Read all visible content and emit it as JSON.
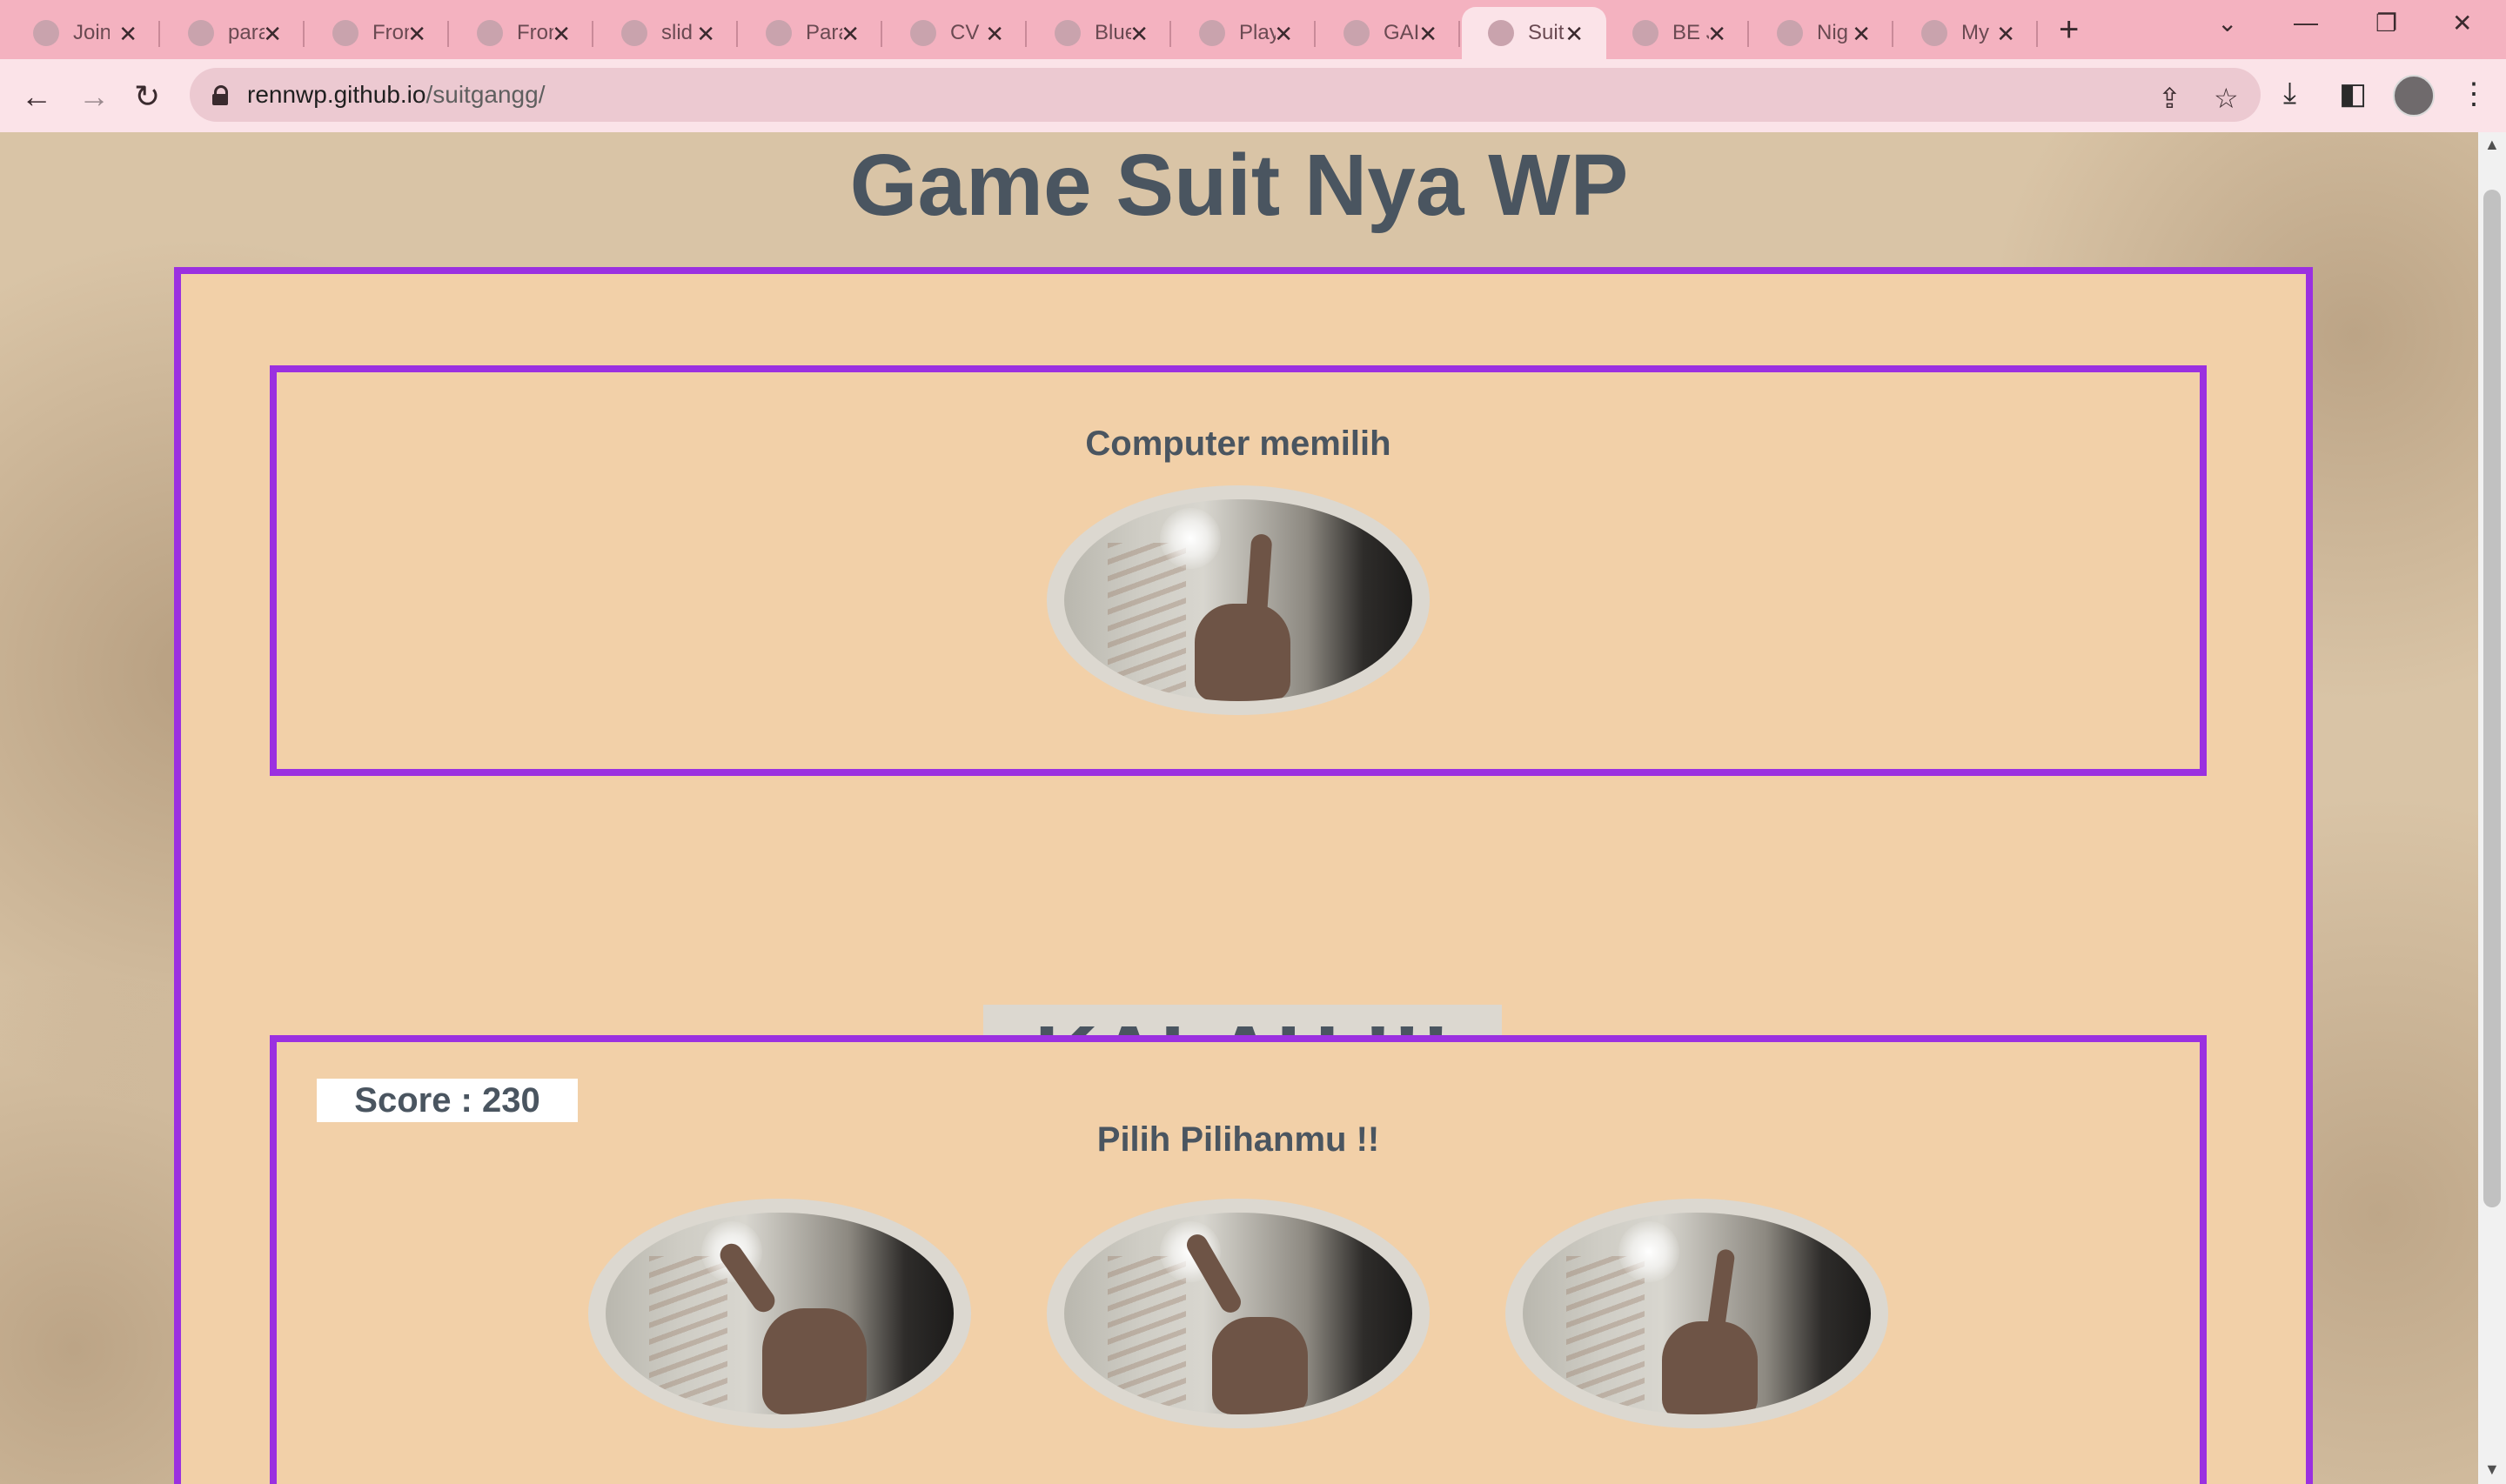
{
  "browser": {
    "tabs": [
      {
        "label": "Join",
        "icon": "person-icon"
      },
      {
        "label": "para",
        "icon": "github-icon"
      },
      {
        "label": "Fron",
        "icon": "page-icon"
      },
      {
        "label": "Fron",
        "icon": "page-icon"
      },
      {
        "label": "slid",
        "icon": "loading-icon"
      },
      {
        "label": "Para",
        "icon": "globe-icon"
      },
      {
        "label": "CV",
        "icon": "globe-icon"
      },
      {
        "label": "Blue",
        "icon": "globe-icon"
      },
      {
        "label": "Play",
        "icon": "globe-icon"
      },
      {
        "label": "GAI",
        "icon": "globe-icon"
      },
      {
        "label": "Suit",
        "icon": "globe-icon",
        "active": true
      },
      {
        "label": "BE J",
        "icon": "globe-icon"
      },
      {
        "label": "Nig",
        "icon": "globe-icon"
      },
      {
        "label": "My",
        "icon": "globe-icon"
      }
    ],
    "url_host": "rennwp.github.io",
    "url_path": "/suitgangg/",
    "accent_color": "#f4b2c0"
  },
  "page": {
    "title": "Game Suit Nya WP",
    "computer_heading": "Computer memilih",
    "result": "KALAH !!!",
    "score_text": "Score : 230",
    "player_heading": "Pilih Pilihanmu !!",
    "computer_choice": "hand-index-finger-icon",
    "player_choices": [
      "hand-thumb-icon",
      "hand-index-finger-icon",
      "hand-pinky-finger-icon"
    ],
    "border_color": "#9b30e0",
    "panel_color": "#f2d0a8"
  }
}
